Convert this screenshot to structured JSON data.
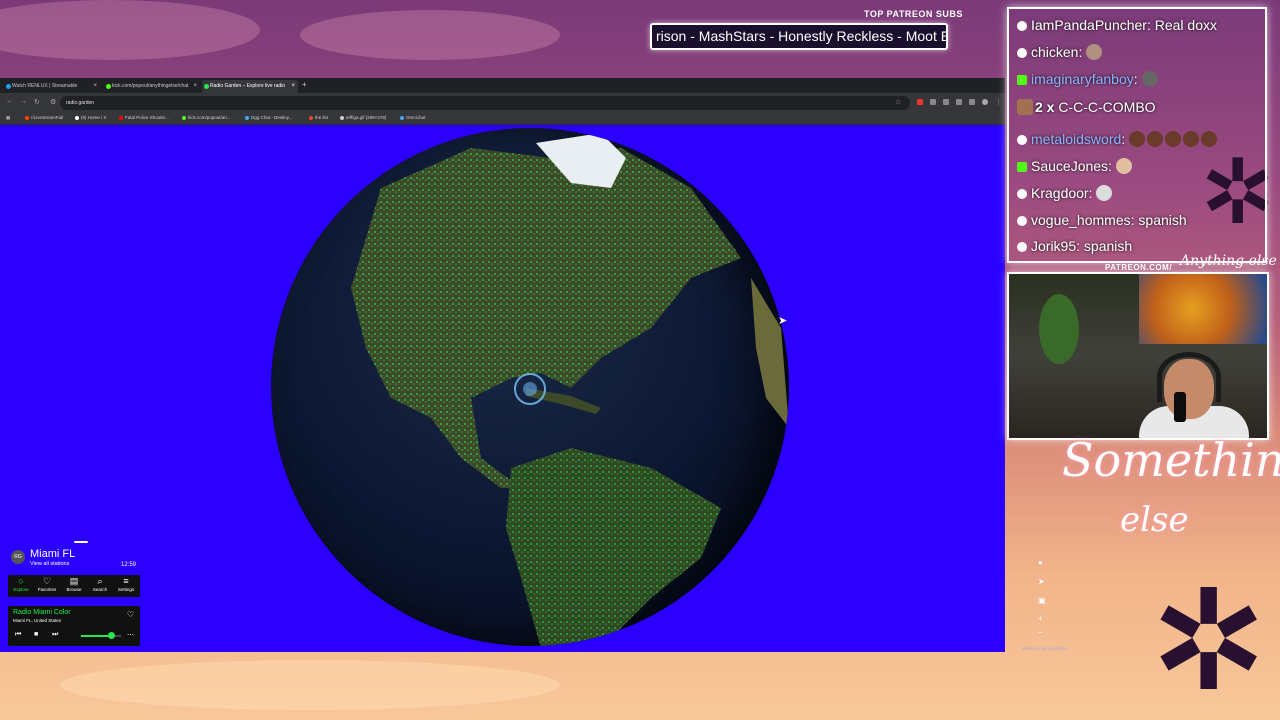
{
  "overlay": {
    "patreon_label": "TOP PATREON SUBS",
    "patreon_ticker": "rison - MashStars - Honestly Reckless - Moot E",
    "patreon_url": "PATREON.COM/",
    "logo_signature": "Anything else",
    "logo_main": "Something",
    "logo_sub": "else"
  },
  "browser": {
    "tabs": [
      {
        "title": "Watch RENLUX | Streamable",
        "color": "#1da1f2"
      },
      {
        "title": "kick.com/popout/anythingelse/chat",
        "color": "#53fc18"
      },
      {
        "title": "Radio Garden – Explore live radio",
        "color": "#27e84f",
        "active": true
      }
    ],
    "new_tab": "+",
    "url": "radio.garden",
    "bookmarks": [
      {
        "label": "r/LivestreamFail",
        "color": "#ff4500"
      },
      {
        "label": "(5) Home / X",
        "color": "#ffffff"
      },
      {
        "label": "Fatal Police Shootin...",
        "color": "#ff0000"
      },
      {
        "label": "kick.com/popout/an...",
        "color": "#53fc18"
      },
      {
        "label": "Dgg Chat - Destiny...",
        "color": "#4aa3ff"
      },
      {
        "label": "the list",
        "color": "#ea4335"
      },
      {
        "label": "erffiga.gif (289×278)",
        "color": "#cccccc"
      },
      {
        "label": "Omnichat",
        "color": "#4aa3ff"
      }
    ]
  },
  "radio": {
    "logo": "RG",
    "city": "Miami FL",
    "view_all": "View all stations",
    "time": "12:59",
    "nav": [
      {
        "icon": "○",
        "label": "Explore",
        "active": true
      },
      {
        "icon": "♡",
        "label": "Favorites"
      },
      {
        "icon": "▤",
        "label": "Browse"
      },
      {
        "icon": "⌕",
        "label": "Search"
      },
      {
        "icon": "≡",
        "label": "Settings"
      }
    ],
    "station_name": "Radio Miami Color",
    "station_location": "Miami FL, United States",
    "volume_level": 0.75,
    "accent": "#27e84f",
    "attribution": "MAPBOX © RADIOGARDEN"
  },
  "chat": [
    {
      "user": "IamPandaPuncher",
      "message": "Real doxx",
      "user_color": "#ffffff",
      "platform": "circle"
    },
    {
      "user": "chicken",
      "message": "",
      "user_color": "#ffffff",
      "platform": "circle",
      "emotes": 1
    },
    {
      "user": "imaginaryfanboy",
      "message": "",
      "user_color": "#8ab4ff",
      "platform": "kick",
      "emotes": 1
    },
    {
      "user": "2 x",
      "message": "C-C-C-COMBO",
      "user_color": "#ffffff",
      "platform": "combo"
    },
    {
      "user": "metaloidsword",
      "message": "",
      "user_color": "#8ab4ff",
      "platform": "circle",
      "emotes": 5
    },
    {
      "user": "SauceJones",
      "message": "",
      "user_color": "#ffffff",
      "platform": "kick",
      "emotes": 1
    },
    {
      "user": "Kragdoor",
      "message": "",
      "user_color": "#ffffff",
      "platform": "circle",
      "emotes": 1
    },
    {
      "user": "vogue_hommes",
      "message": "spanish",
      "user_color": "#ffffff",
      "platform": "circle"
    },
    {
      "user": "Jorik95",
      "message": "spanish",
      "user_color": "#ffffff",
      "platform": "circle"
    }
  ]
}
